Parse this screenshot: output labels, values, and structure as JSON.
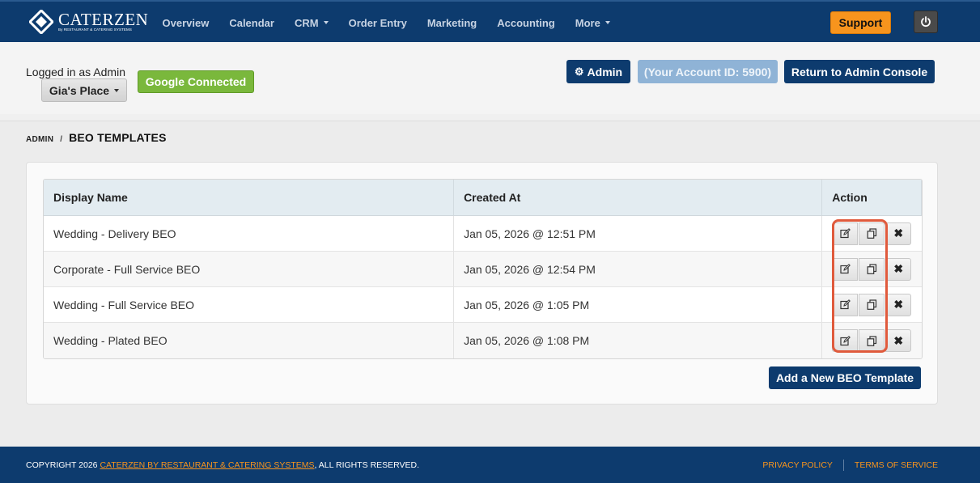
{
  "brand": {
    "name": "CATERZEN",
    "tagline": "By RESTAURANT & CATERING SYSTEMS"
  },
  "nav": {
    "items": [
      {
        "label": "Overview",
        "dropdown": false
      },
      {
        "label": "Calendar",
        "dropdown": false
      },
      {
        "label": "CRM",
        "dropdown": true
      },
      {
        "label": "Order Entry",
        "dropdown": false
      },
      {
        "label": "Marketing",
        "dropdown": false
      },
      {
        "label": "Accounting",
        "dropdown": false
      },
      {
        "label": "More",
        "dropdown": true
      }
    ],
    "support_label": "Support"
  },
  "account": {
    "logged_in_text": "Logged in as Admin",
    "location_label": "Gia's Place",
    "google_label": "Google Connected",
    "admin_label": "Admin",
    "account_id_label": "(Your Account ID: 5900)",
    "return_label": "Return to Admin Console"
  },
  "breadcrumb": {
    "root": "ADMIN",
    "separator": "/",
    "current": "BEO TEMPLATES"
  },
  "table": {
    "headers": [
      "Display Name",
      "Created At",
      "Action"
    ],
    "rows": [
      {
        "name": "Wedding - Delivery BEO",
        "created": "Jan 05, 2026 @ 12:51 PM"
      },
      {
        "name": "Corporate - Full Service BEO",
        "created": "Jan 05, 2026 @ 12:54 PM"
      },
      {
        "name": "Wedding - Full Service BEO",
        "created": "Jan 05, 2026 @ 1:05 PM"
      },
      {
        "name": "Wedding - Plated BEO",
        "created": "Jan 05, 2026 @ 1:08 PM"
      }
    ]
  },
  "add_button_label": "Add a New BEO Template",
  "footer": {
    "copyright_prefix": "COPYRIGHT 2026 ",
    "copyright_link": "CATERZEN BY RESTAURANT & CATERING SYSTEMS",
    "copyright_suffix": ", ALL RIGHTS RESERVED.",
    "privacy": "PRIVACY POLICY",
    "terms": "TERMS OF SERVICE"
  },
  "colors": {
    "navy": "#0d3b6e",
    "orange": "#f7941d",
    "green": "#7ab83c",
    "highlight": "#e05a3c"
  }
}
